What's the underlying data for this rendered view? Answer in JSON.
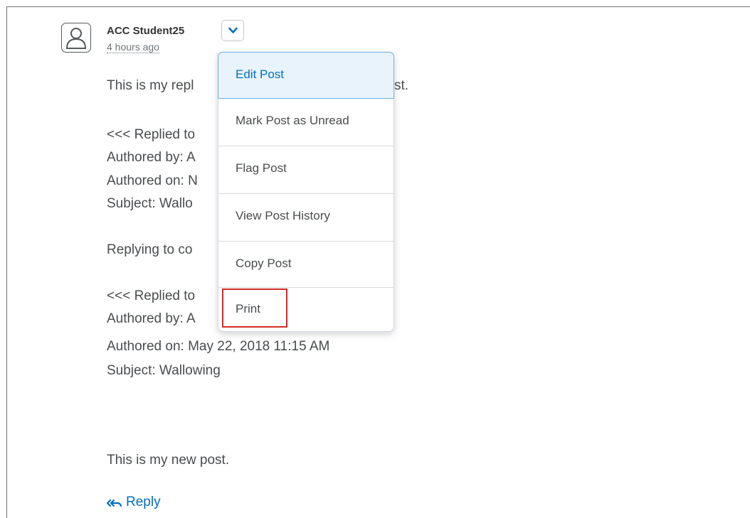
{
  "post": {
    "author": "ACC Student25",
    "timestamp": "4 hours ago",
    "body_lines": [
      "This is my repl",
      "st.",
      "<<< Replied to",
      "Authored by: A",
      "Authored on: N",
      "Subject: Wallo",
      "Replying to co",
      "<<< Replied to",
      "Authored by: A",
      "Authored on: May 22, 2018 11:15 AM",
      "Subject: Wallowing",
      "This is my new post."
    ],
    "reply_label": "Reply"
  },
  "context_menu": {
    "items": [
      {
        "label": "Edit Post"
      },
      {
        "label": "Mark Post as Unread"
      },
      {
        "label": "Flag Post"
      },
      {
        "label": "View Post History"
      },
      {
        "label": "Copy Post"
      },
      {
        "label": "Print"
      }
    ]
  },
  "colors": {
    "link": "#006fbf",
    "highlight_box": "#d42b2b",
    "active_item_bg": "#e9f3fb"
  },
  "icons": {
    "avatar": "user-avatar-icon",
    "menu_toggle": "chevron-down-icon",
    "reply": "reply-arrows-icon"
  }
}
